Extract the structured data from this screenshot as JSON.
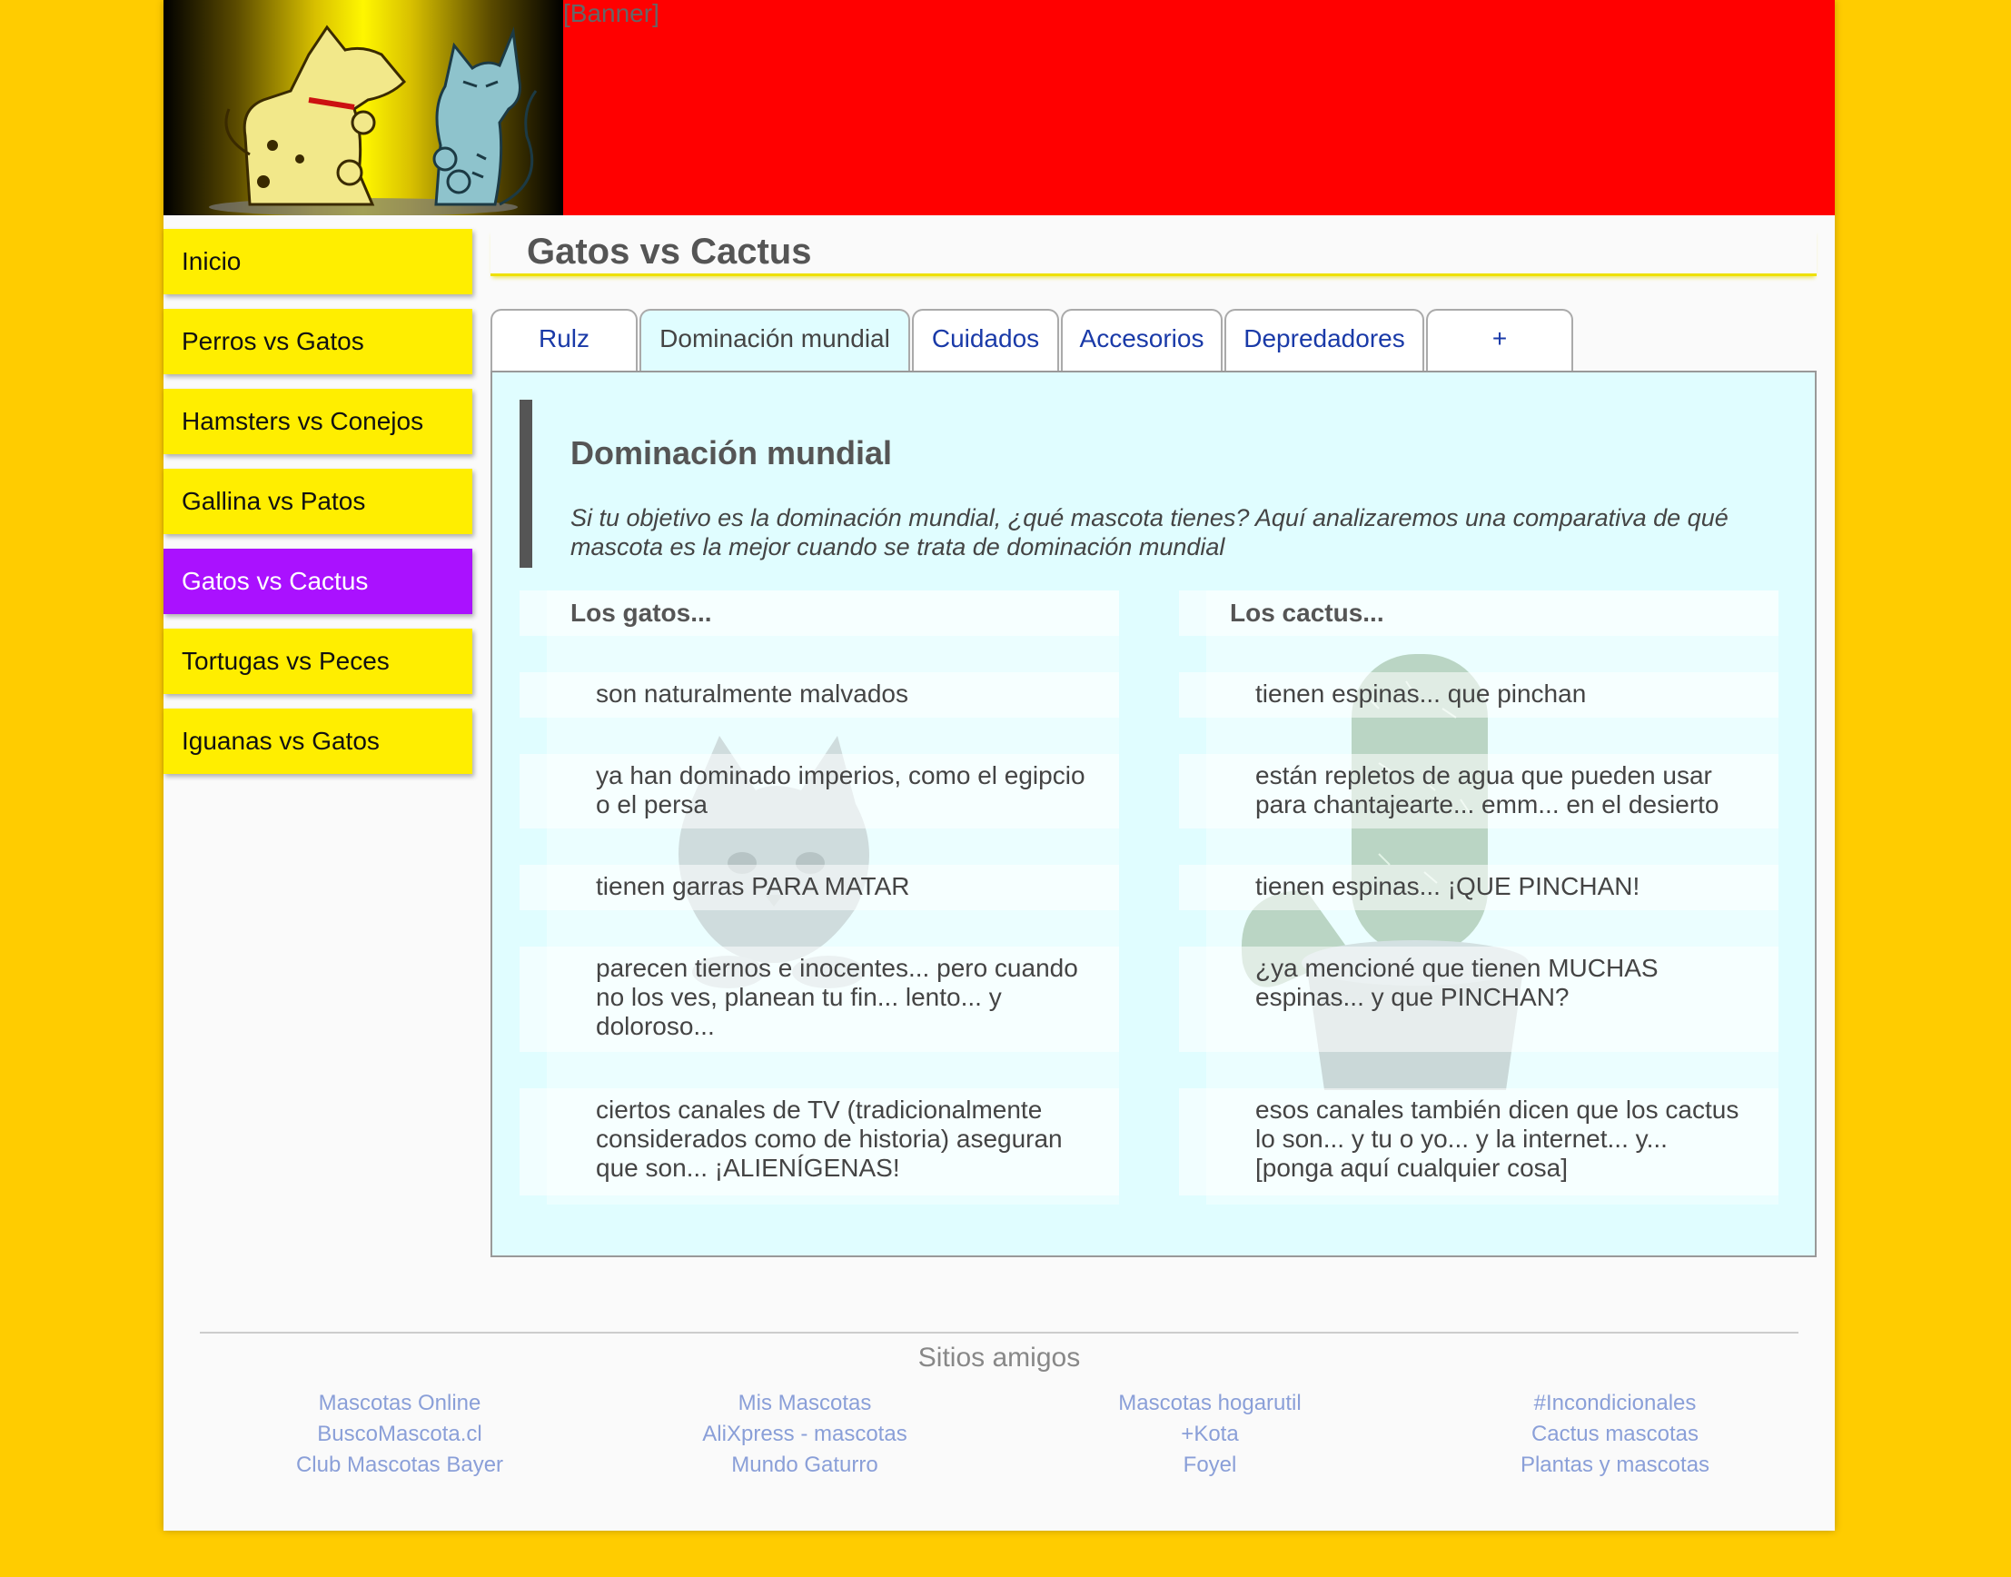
{
  "header": {
    "banner_text": "[Banner]",
    "colors": {
      "header": "#FF0000",
      "background": "#FFCC00"
    }
  },
  "sidebar": {
    "items": [
      {
        "label": "Inicio"
      },
      {
        "label": "Perros vs Gatos"
      },
      {
        "label": "Hamsters vs Conejos"
      },
      {
        "label": "Gallina vs Patos"
      },
      {
        "label": "Gatos vs Cactus",
        "active": true
      },
      {
        "label": "Tortugas vs Peces"
      },
      {
        "label": "Iguanas vs Gatos"
      }
    ],
    "colors": {
      "item": "#FFEE00",
      "active": "#AA11FF"
    }
  },
  "main": {
    "title": "Gatos vs Cactus",
    "tabs": [
      {
        "label": "Rulz"
      },
      {
        "label": "Dominación mundial",
        "active": true
      },
      {
        "label": "Cuidados"
      },
      {
        "label": "Accesorios"
      },
      {
        "label": "Depredadores"
      },
      {
        "label": "+"
      }
    ],
    "panel": {
      "heading": "Dominación mundial",
      "intro": "Si tu objetivo es la dominación mundial, ¿qué mascota tienes? Aquí analizaremos una comparativa de qué mascota es la mejor cuando se trata de dominación mundial",
      "left_column": {
        "title": "Los gatos...",
        "items": [
          "son naturalmente malvados",
          "ya han dominado imperios, como el egipcio o el persa",
          "tienen garras PARA MATAR",
          "parecen tiernos e inocentes... pero cuando no los ves, planean tu fin... lento... y doloroso...",
          "ciertos canales de TV (tradicionalmente considerados como de historia) aseguran que son... ¡ALIENÍGENAS!"
        ]
      },
      "right_column": {
        "title": "Los cactus...",
        "items": [
          "tienen espinas... que pinchan",
          "están repletos de agua que pueden usar para chantajearte... emm... en el desierto",
          "tienen espinas... ¡QUE PINCHAN!",
          "¿ya mencioné que tienen MUCHAS espinas... y que PINCHAN?",
          "esos canales también dicen que los cactus lo son... y tu o yo... y la internet... y... [ponga aquí cualquier cosa]"
        ]
      }
    }
  },
  "footer": {
    "title": "Sitios amigos",
    "columns": [
      [
        "Mascotas Online",
        "BuscoMascota.cl",
        "Club Mascotas Bayer"
      ],
      [
        "Mis Mascotas",
        "AliXpress - mascotas",
        "Mundo Gaturro"
      ],
      [
        "Mascotas hogarutil",
        "+Kota",
        "Foyel"
      ],
      [
        "#Incondicionales",
        "Cactus mascotas",
        "Plantas y mascotas"
      ]
    ]
  }
}
